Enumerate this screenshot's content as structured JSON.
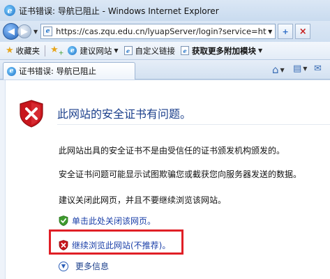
{
  "window": {
    "title": "证书错误: 导航已阻止 - Windows Internet Explorer",
    "app_icon_glyph": "e"
  },
  "navigation": {
    "address_url": "https://cas.zqu.edu.cn/lyuapServer/login?service=htt",
    "refresh_glyph": "+",
    "close_glyph": "×"
  },
  "favorites_bar": {
    "favorites_label": "收藏夹",
    "items": [
      {
        "label": "建议网站",
        "has_dropdown": true
      },
      {
        "label": "自定义链接",
        "has_dropdown": false
      },
      {
        "label": "获取更多附加模块",
        "has_dropdown": true
      }
    ]
  },
  "tabs": [
    {
      "label": "证书错误: 导航已阻止",
      "active": true
    }
  ],
  "page": {
    "heading": "此网站的安全证书有问题。",
    "paragraphs": [
      "此网站出具的安全证书不是由受信任的证书颁发机构颁发的。",
      "安全证书问题可能显示试图欺骗您或截获您向服务器发送的数据。",
      "建议关闭此网页，并且不要继续浏览该网站。"
    ],
    "options": {
      "close_page": "单击此处关闭该网页。",
      "continue_site": "继续浏览此网站(不推荐)。",
      "more_info": "更多信息"
    }
  },
  "colors": {
    "heading": "#1b3f8b",
    "link": "#1a3fa8",
    "highlight_box": "#e01f26",
    "shield_red": "#c8161d",
    "shield_green": "#3f9b2e"
  }
}
